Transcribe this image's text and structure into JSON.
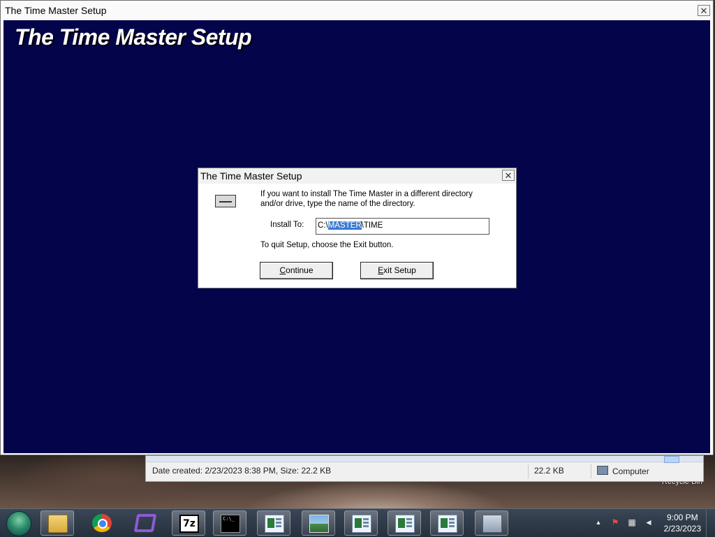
{
  "main_window": {
    "title": "The Time Master Setup",
    "close_glyph": "✕",
    "banner": "The Time Master Setup"
  },
  "dialog": {
    "title": "The Time Master Setup",
    "close_glyph": "✕",
    "message_line1": "If you want to install The Time Master in a different directory",
    "message_line2": "and/or drive, type the name of the directory.",
    "install_label": "Install To:",
    "path_prefix": "C:\\",
    "path_selected": "MASTER",
    "path_suffix": "\\TIME",
    "quit_text": "To quit Setup, choose the Exit button.",
    "continue_hotkey": "C",
    "continue_rest": "ontinue",
    "exit_hotkey": "E",
    "exit_rest": "xit Setup"
  },
  "explorer_status": {
    "details": "Date created: 2/23/2023 8:38 PM, Size: 22.2 KB",
    "size": "22.2 KB",
    "location": "Computer"
  },
  "desktop": {
    "recycle_bin_label": "Recycle Bin"
  },
  "taskbar": {
    "pinned": [
      {
        "icon": "windows-explorer-folder-icon"
      },
      {
        "icon": "chrome-icon"
      },
      {
        "icon": "visual-studio-icon"
      },
      {
        "icon": "7zip-icon",
        "text": "7z"
      },
      {
        "icon": "command-prompt-icon",
        "text": "C:\\_"
      }
    ],
    "clock_time": "9:00 PM",
    "clock_date": "2/23/2023",
    "tray_arrow": "▲"
  }
}
